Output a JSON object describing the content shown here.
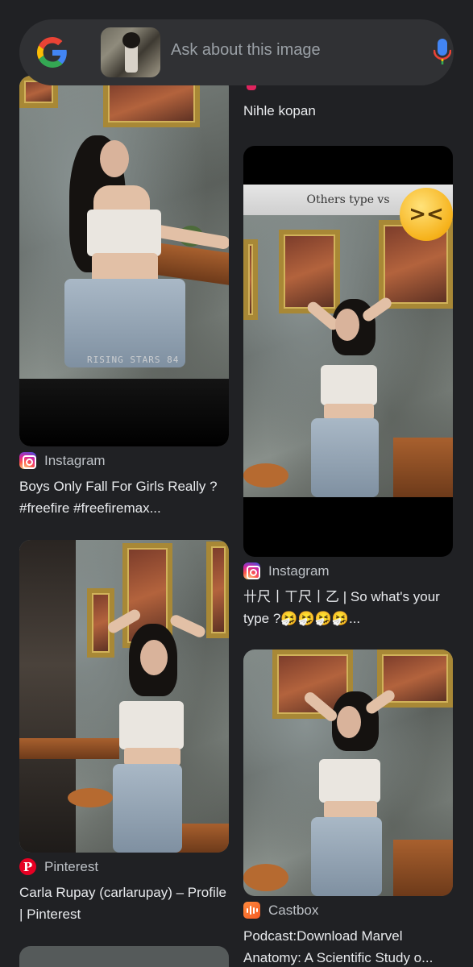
{
  "search": {
    "placeholder": "Ask about this image"
  },
  "icons": {
    "google": "google-g-logo",
    "mic": "mic-icon",
    "instagram": "instagram-icon",
    "pinterest": "pinterest-icon",
    "castbox": "castbox-icon"
  },
  "colors": {
    "background": "#202124",
    "search_bar": "#303134",
    "text_primary": "#e8eaed",
    "text_secondary": "#bdc1c6",
    "pinterest_red": "#e60023",
    "castbox_orange": "#f55b23"
  },
  "results": {
    "left": [
      {
        "source": "Instagram",
        "title": "Boys Only Fall For Girls Really ? #freefire #freefiremax...",
        "watermark": "RISING STARS 84"
      },
      {
        "source": "Pinterest",
        "title": "Carla Rupay (carlarupay) – Profile | Pinterest"
      }
    ],
    "right": [
      {
        "title": "Nihle kopan"
      },
      {
        "source": "Instagram",
        "title": "卄尺丨ㄒ尺丨乙 | So what's your type ?🤧🤧🤧🤧...",
        "overlay_text": "Others type vs"
      },
      {
        "source": "Castbox",
        "title": "Podcast:Download Marvel Anatomy: A Scientific Study o..."
      }
    ]
  }
}
